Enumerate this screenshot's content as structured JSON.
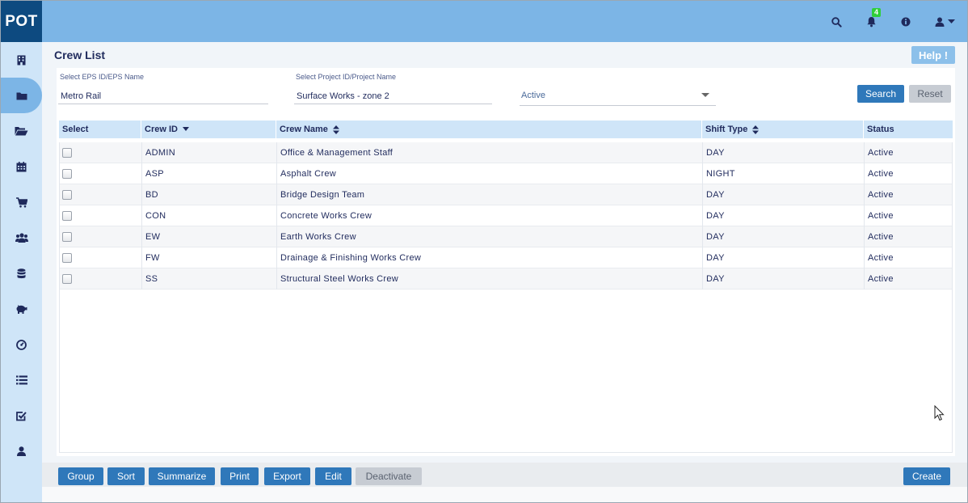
{
  "app": {
    "logo": "POT"
  },
  "topbar": {
    "icons": [
      "search-icon",
      "bell-icon",
      "info-icon",
      "user-icon"
    ],
    "notifications_count": "4"
  },
  "sidebar": {
    "items": [
      {
        "icon": "building-icon"
      },
      {
        "icon": "folder-icon",
        "active": true
      },
      {
        "icon": "folder-open-icon"
      },
      {
        "icon": "calendar-icon"
      },
      {
        "icon": "cart-icon"
      },
      {
        "icon": "users-icon"
      },
      {
        "icon": "database-icon"
      },
      {
        "icon": "piggy-bank-icon"
      },
      {
        "icon": "dashboard-icon"
      },
      {
        "icon": "list-icon"
      },
      {
        "icon": "check-square-icon"
      },
      {
        "icon": "user-icon"
      }
    ]
  },
  "page": {
    "title": "Crew List",
    "help_label": "Help !"
  },
  "filters": {
    "eps_label": "Select EPS ID/EPS Name",
    "eps_value": "Metro Rail",
    "project_label": "Select Project ID/Project Name",
    "project_value": "Surface Works - zone 2",
    "status_value": "Active",
    "search_label": "Search",
    "reset_label": "Reset"
  },
  "table": {
    "headers": {
      "select": "Select",
      "crew_id": "Crew ID",
      "crew_name": "Crew Name",
      "shift_type": "Shift Type",
      "status": "Status"
    },
    "rows": [
      {
        "id": "ADMIN",
        "name": "Office & Management Staff",
        "shift": "DAY",
        "status": "Active"
      },
      {
        "id": "ASP",
        "name": "Asphalt Crew",
        "shift": "NIGHT",
        "status": "Active"
      },
      {
        "id": "BD",
        "name": "Bridge Design Team",
        "shift": "DAY",
        "status": "Active"
      },
      {
        "id": "CON",
        "name": "Concrete Works Crew",
        "shift": "DAY",
        "status": "Active"
      },
      {
        "id": "EW",
        "name": "Earth Works Crew",
        "shift": "DAY",
        "status": "Active"
      },
      {
        "id": "FW",
        "name": "Drainage & Finishing Works Crew",
        "shift": "DAY",
        "status": "Active"
      },
      {
        "id": "SS",
        "name": "Structural Steel Works Crew",
        "shift": "DAY",
        "status": "Active"
      }
    ]
  },
  "actions": {
    "group": "Group",
    "sort": "Sort",
    "summarize": "Summarize",
    "print": "Print",
    "export": "Export",
    "edit": "Edit",
    "deactivate": "Deactivate",
    "create": "Create"
  },
  "colors": {
    "topbar": "#7cb5e6",
    "logo_bg": "#0d4a80",
    "sidebar": "#cfe5f8",
    "primary_button": "#2f78ba",
    "disabled_button": "#c7ccd3",
    "badge": "#2fcf3a"
  }
}
